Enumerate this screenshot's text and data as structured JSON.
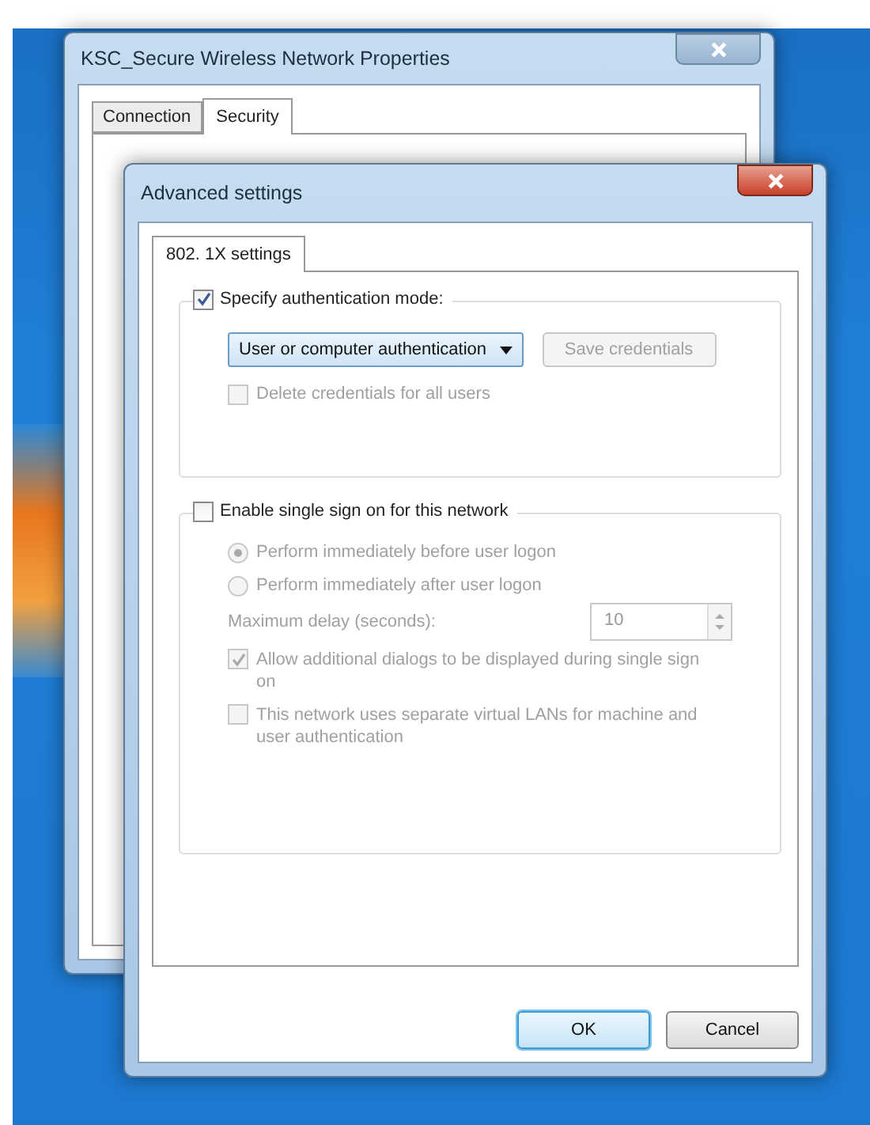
{
  "background_window": {
    "title": "KSC_Secure Wireless Network Properties",
    "tabs": [
      {
        "label": "Connection",
        "selected": false
      },
      {
        "label": "Security",
        "selected": true
      }
    ]
  },
  "dialog": {
    "title": "Advanced settings",
    "tabs": [
      {
        "label": "802. 1X settings",
        "selected": true
      }
    ],
    "auth_group": {
      "checkbox": {
        "label": "Specify authentication mode:",
        "checked": true
      },
      "mode_select": {
        "value": "User or computer authentication"
      },
      "save_button": {
        "label": "Save credentials",
        "disabled": true
      },
      "delete_checkbox": {
        "label": "Delete credentials for all users",
        "checked": false,
        "disabled": true
      }
    },
    "sso_group": {
      "checkbox": {
        "label": "Enable single sign on for this network",
        "checked": false
      },
      "options": [
        {
          "label": "Perform immediately before user logon",
          "selected": true,
          "disabled": true
        },
        {
          "label": "Perform immediately after user logon",
          "selected": false,
          "disabled": true
        }
      ],
      "delay": {
        "label": "Maximum delay (seconds):",
        "value": "10",
        "disabled": true
      },
      "checks": [
        {
          "label": "Allow additional dialogs to be displayed during single sign on",
          "checked": true,
          "disabled": true
        },
        {
          "label": "This network uses separate virtual LANs for machine and user authentication",
          "checked": false,
          "disabled": true
        }
      ]
    },
    "buttons": [
      {
        "label": "OK",
        "default": true
      },
      {
        "label": "Cancel",
        "default": false
      }
    ]
  }
}
